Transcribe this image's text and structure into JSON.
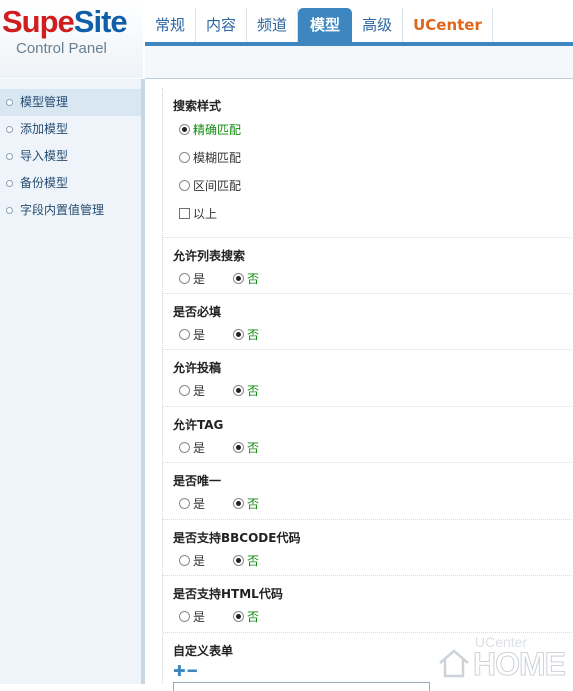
{
  "logo": {
    "brand_part1": "Supe",
    "brand_part2": "Site",
    "subtitle": "Control Panel"
  },
  "tabs": [
    {
      "label": "常规"
    },
    {
      "label": "内容"
    },
    {
      "label": "频道"
    },
    {
      "label": "模型",
      "active": true
    },
    {
      "label": "高级"
    },
    {
      "label": "UCenter"
    }
  ],
  "sidebar": {
    "items": [
      {
        "label": "模型管理",
        "active": true
      },
      {
        "label": "添加模型"
      },
      {
        "label": "导入模型"
      },
      {
        "label": "备份模型"
      },
      {
        "label": "字段内置值管理"
      }
    ]
  },
  "form": {
    "search_style": {
      "label": "搜索样式",
      "options": [
        "精确匹配",
        "模糊匹配",
        "区间匹配"
      ],
      "selected": 0,
      "checkbox_label": "以上",
      "checkbox_checked": false
    },
    "yes_label": "是",
    "no_label": "否",
    "fields": [
      {
        "label": "允许列表搜索",
        "value": "否"
      },
      {
        "label": "是否必填",
        "value": "否"
      },
      {
        "label": "允许投稿",
        "value": "否"
      },
      {
        "label": "允许TAG",
        "value": "否"
      },
      {
        "label": "是否唯一",
        "value": "否"
      },
      {
        "label": "是否支持BBCODE代码",
        "value": "否"
      },
      {
        "label": "是否支持HTML代码",
        "value": "否"
      }
    ],
    "custom_form_label": "自定义表单"
  },
  "watermark": {
    "small": "UCenter",
    "big": "HOME"
  },
  "colors": {
    "accent": "#3d86c0",
    "selected_option": "#108a10",
    "brand_red": "#d01e1e",
    "brand_blue": "#0f5fa8",
    "ucenter": "#e0661a"
  }
}
